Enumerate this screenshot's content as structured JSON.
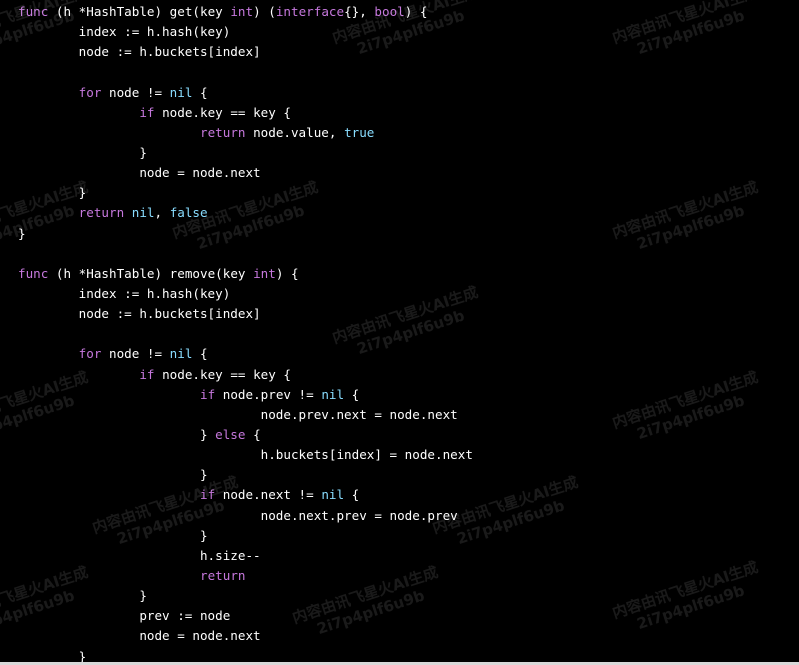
{
  "colors": {
    "background": "#000000",
    "text": "#ffffff",
    "keyword": "#c678dd",
    "constant": "#89ddff"
  },
  "watermark": {
    "line1": "内容由讯飞星火AI生成",
    "line2": "2i7p4plf6u9b"
  },
  "code": {
    "language": "go",
    "lines": [
      [
        {
          "t": "kw",
          "v": "func"
        },
        {
          "t": "plain",
          "v": " (h *HashTable) get(key "
        },
        {
          "t": "type",
          "v": "int"
        },
        {
          "t": "plain",
          "v": ") ("
        },
        {
          "t": "type",
          "v": "interface"
        },
        {
          "t": "plain",
          "v": "{}, "
        },
        {
          "t": "type",
          "v": "bool"
        },
        {
          "t": "plain",
          "v": ") {"
        }
      ],
      [
        {
          "t": "plain",
          "v": "        index := h.hash(key)"
        }
      ],
      [
        {
          "t": "plain",
          "v": "        node := h.buckets[index]"
        }
      ],
      [],
      [
        {
          "t": "plain",
          "v": "        "
        },
        {
          "t": "kw",
          "v": "for"
        },
        {
          "t": "plain",
          "v": " node != "
        },
        {
          "t": "const",
          "v": "nil"
        },
        {
          "t": "plain",
          "v": " {"
        }
      ],
      [
        {
          "t": "plain",
          "v": "                "
        },
        {
          "t": "kw",
          "v": "if"
        },
        {
          "t": "plain",
          "v": " node.key == key {"
        }
      ],
      [
        {
          "t": "plain",
          "v": "                        "
        },
        {
          "t": "kw",
          "v": "return"
        },
        {
          "t": "plain",
          "v": " node.value, "
        },
        {
          "t": "const",
          "v": "true"
        }
      ],
      [
        {
          "t": "plain",
          "v": "                }"
        }
      ],
      [
        {
          "t": "plain",
          "v": "                node = node.next"
        }
      ],
      [
        {
          "t": "plain",
          "v": "        }"
        }
      ],
      [
        {
          "t": "plain",
          "v": "        "
        },
        {
          "t": "kw",
          "v": "return"
        },
        {
          "t": "plain",
          "v": " "
        },
        {
          "t": "const",
          "v": "nil"
        },
        {
          "t": "plain",
          "v": ", "
        },
        {
          "t": "const",
          "v": "false"
        }
      ],
      [
        {
          "t": "plain",
          "v": "}"
        }
      ],
      [],
      [
        {
          "t": "kw",
          "v": "func"
        },
        {
          "t": "plain",
          "v": " (h *HashTable) remove(key "
        },
        {
          "t": "type",
          "v": "int"
        },
        {
          "t": "plain",
          "v": ") {"
        }
      ],
      [
        {
          "t": "plain",
          "v": "        index := h.hash(key)"
        }
      ],
      [
        {
          "t": "plain",
          "v": "        node := h.buckets[index]"
        }
      ],
      [],
      [
        {
          "t": "plain",
          "v": "        "
        },
        {
          "t": "kw",
          "v": "for"
        },
        {
          "t": "plain",
          "v": " node != "
        },
        {
          "t": "const",
          "v": "nil"
        },
        {
          "t": "plain",
          "v": " {"
        }
      ],
      [
        {
          "t": "plain",
          "v": "                "
        },
        {
          "t": "kw",
          "v": "if"
        },
        {
          "t": "plain",
          "v": " node.key == key {"
        }
      ],
      [
        {
          "t": "plain",
          "v": "                        "
        },
        {
          "t": "kw",
          "v": "if"
        },
        {
          "t": "plain",
          "v": " node.prev != "
        },
        {
          "t": "const",
          "v": "nil"
        },
        {
          "t": "plain",
          "v": " {"
        }
      ],
      [
        {
          "t": "plain",
          "v": "                                node.prev.next = node.next"
        }
      ],
      [
        {
          "t": "plain",
          "v": "                        } "
        },
        {
          "t": "kw",
          "v": "else"
        },
        {
          "t": "plain",
          "v": " {"
        }
      ],
      [
        {
          "t": "plain",
          "v": "                                h.buckets[index] = node.next"
        }
      ],
      [
        {
          "t": "plain",
          "v": "                        }"
        }
      ],
      [
        {
          "t": "plain",
          "v": "                        "
        },
        {
          "t": "kw",
          "v": "if"
        },
        {
          "t": "plain",
          "v": " node.next != "
        },
        {
          "t": "const",
          "v": "nil"
        },
        {
          "t": "plain",
          "v": " {"
        }
      ],
      [
        {
          "t": "plain",
          "v": "                                node.next.prev = node.prev"
        }
      ],
      [
        {
          "t": "plain",
          "v": "                        }"
        }
      ],
      [
        {
          "t": "plain",
          "v": "                        h.size--"
        }
      ],
      [
        {
          "t": "plain",
          "v": "                        "
        },
        {
          "t": "kw",
          "v": "return"
        }
      ],
      [
        {
          "t": "plain",
          "v": "                }"
        }
      ],
      [
        {
          "t": "plain",
          "v": "                prev := node"
        }
      ],
      [
        {
          "t": "plain",
          "v": "                node = node.next"
        }
      ],
      [
        {
          "t": "plain",
          "v": "        }"
        }
      ]
    ]
  }
}
